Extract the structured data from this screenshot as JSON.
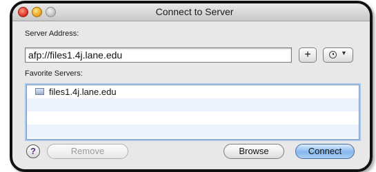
{
  "window": {
    "title": "Connect to Server"
  },
  "server_address": {
    "label": "Server Address:",
    "value": "afp://files1.4j.lane.edu",
    "add_button": "+",
    "recent_icon": "clock-icon"
  },
  "favorites": {
    "label": "Favorite Servers:",
    "items": [
      {
        "label": "files1.4j.lane.edu",
        "icon": "server-icon"
      }
    ]
  },
  "buttons": {
    "help": "?",
    "remove": "Remove",
    "browse": "Browse",
    "connect": "Connect"
  },
  "colors": {
    "accent": "#86b7ec",
    "list_focus": "#a9c5e7",
    "close": "#d22b18",
    "minimize": "#e59d12"
  }
}
